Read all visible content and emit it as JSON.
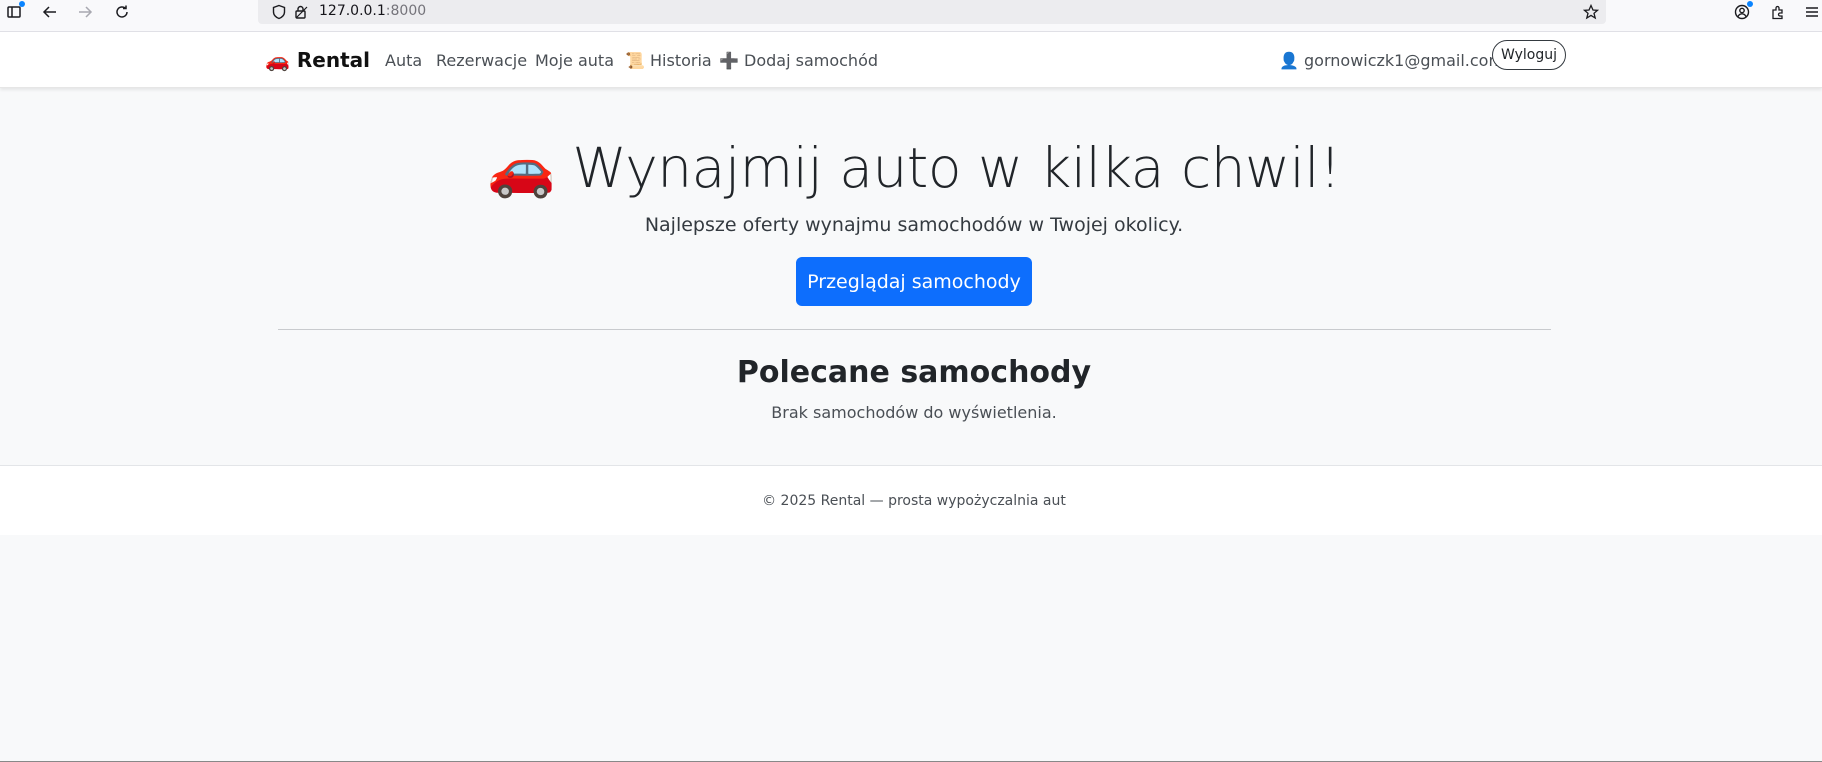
{
  "browser": {
    "url_host": "127.0.0.1",
    "url_port": ":8000"
  },
  "navbar": {
    "brand_icon": "🚗",
    "brand": "Rental",
    "links": [
      {
        "label": "Auta"
      },
      {
        "label": "Rezerwacje"
      },
      {
        "label": "Moje auta"
      },
      {
        "label": "Historia",
        "icon": "📜"
      },
      {
        "label": "Dodaj samochód",
        "icon": "➕"
      }
    ],
    "user_icon": "👤",
    "user_email": "gornowiczk1@gmail.com",
    "logout_label": "Wyloguj"
  },
  "hero": {
    "icon": "🚗",
    "title": "Wynajmij auto w kilka chwil!",
    "subtitle": "Najlepsze oferty wynajmu samochodów w Twojej okolicy.",
    "cta_label": "Przeglądaj samochody"
  },
  "featured": {
    "title": "Polecane samochody",
    "empty_message": "Brak samochodów do wyświetlenia."
  },
  "footer": {
    "text": "© 2025 Rental — prosta wypożyczalnia aut"
  },
  "colors": {
    "primary": "#0d6efd",
    "page_bg": "#f8f9fa"
  }
}
